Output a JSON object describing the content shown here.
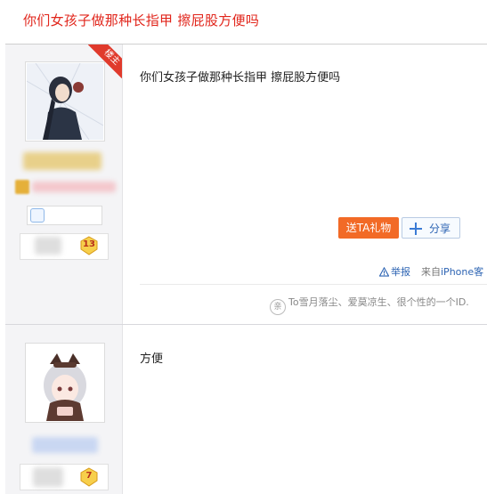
{
  "thread": {
    "title": "你们女孩子做那种长指甲 擦屁股方便吗"
  },
  "posts": [
    {
      "badge": "楼主",
      "content": "你们女孩子做那种长指甲 擦屁股方便吗",
      "level": "13",
      "gift_label": "送TA礼物",
      "share_label": "分享",
      "report_label": "举报",
      "source_prefix": "来自",
      "source_device": "iPhone客",
      "signature": "To雪月落尘、爱莫凉生、很个性的一个ID.",
      "signature_icon": "亲"
    },
    {
      "content": "方便",
      "level": "7"
    }
  ],
  "colors": {
    "accent_red": "#e1251b",
    "gift_orange": "#f26a26",
    "link_blue": "#2d64b3"
  }
}
